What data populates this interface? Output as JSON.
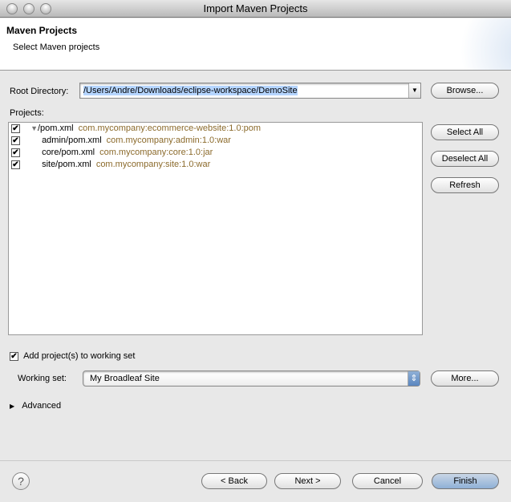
{
  "window": {
    "title": "Import Maven Projects"
  },
  "header": {
    "title": "Maven Projects",
    "subtitle": "Select Maven projects"
  },
  "root": {
    "label": "Root Directory:",
    "value": "/Users/Andre/Downloads/eclipse-workspace/DemoSite",
    "browse": "Browse..."
  },
  "projects": {
    "label": "Projects:",
    "items": [
      {
        "path": "/pom.xml",
        "coord": "com.mycompany:ecommerce-website:1.0:pom",
        "checked": true
      },
      {
        "path": "admin/pom.xml",
        "coord": "com.mycompany:admin:1.0:war",
        "checked": true
      },
      {
        "path": "core/pom.xml",
        "coord": "com.mycompany:core:1.0:jar",
        "checked": true
      },
      {
        "path": "site/pom.xml",
        "coord": "com.mycompany:site:1.0:war",
        "checked": true
      }
    ],
    "select_all": "Select All",
    "deselect_all": "Deselect All",
    "refresh": "Refresh"
  },
  "working_set": {
    "checkbox_label": "Add project(s) to working set",
    "checked": true,
    "label": "Working set:",
    "value": "My Broadleaf Site",
    "more": "More..."
  },
  "advanced": {
    "label": "Advanced"
  },
  "footer": {
    "help": "?",
    "back": "< Back",
    "next": "Next >",
    "cancel": "Cancel",
    "finish": "Finish"
  },
  "icons": {
    "check": "✔",
    "expanded": "▼",
    "collapsed": "▶",
    "dropdown": "▼",
    "stepper": "⇕"
  }
}
